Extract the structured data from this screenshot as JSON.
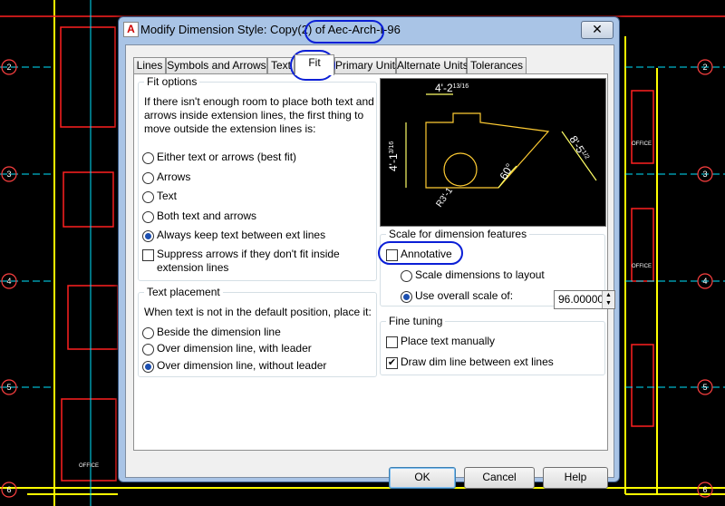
{
  "window": {
    "title_prefix": "Modify Dimension Style: Copy(2) of ",
    "title_style": "Aec-Arch-I-96",
    "app_icon": "A",
    "close_glyph": "✕"
  },
  "tabs": [
    {
      "label": "Lines"
    },
    {
      "label": "Symbols and Arrows"
    },
    {
      "label": "Text"
    },
    {
      "label": "Fit",
      "active": true
    },
    {
      "label": "Primary Units"
    },
    {
      "label": "Alternate Units"
    },
    {
      "label": "Tolerances"
    }
  ],
  "fit_options": {
    "title": "Fit options",
    "description_lines": [
      "If there isn't enough room to place both text and",
      "arrows inside extension lines, the first thing to",
      "move outside the extension lines is:"
    ],
    "radios": [
      {
        "label": "Either text or arrows (best fit)",
        "selected": false
      },
      {
        "label": "Arrows",
        "selected": false
      },
      {
        "label": "Text",
        "selected": false
      },
      {
        "label": "Both text and arrows",
        "selected": false
      },
      {
        "label": "Always keep text between ext lines",
        "selected": true
      }
    ],
    "suppress_lines": [
      "Suppress arrows if they don't fit inside",
      "extension lines"
    ],
    "suppress_checked": false
  },
  "text_placement": {
    "title": "Text placement",
    "description": "When text is not in the default position, place it:",
    "radios": [
      {
        "label": "Beside the dimension line",
        "selected": false
      },
      {
        "label": "Over dimension line, with leader",
        "selected": false
      },
      {
        "label": "Over dimension line, without leader",
        "selected": true
      }
    ]
  },
  "scale": {
    "title": "Scale for dimension features",
    "annotative_label": "Annotative",
    "annotative_checked": false,
    "layout_label": "Scale dimensions to layout",
    "layout_selected": false,
    "overall_label": "Use overall scale of:",
    "overall_selected": true,
    "overall_value": "96.00000"
  },
  "fine_tuning": {
    "title": "Fine tuning",
    "manual_label": "Place text manually",
    "manual_checked": false,
    "drawdim_label": "Draw dim line between ext lines",
    "drawdim_checked": true
  },
  "preview": {
    "top_dim": "4'-2",
    "top_frac": "13/16",
    "left_dim": "4'-1",
    "left_frac": "3/16",
    "right_dim": "8'-5",
    "right_frac": "1/2",
    "angle_dim": "60°",
    "radius_dim": "R3'-1"
  },
  "buttons": {
    "ok": "OK",
    "cancel": "Cancel",
    "help": "Help"
  },
  "background_labels": {
    "grid": [
      "2",
      "3",
      "4",
      "5",
      "6"
    ],
    "office": "OFFICE"
  },
  "colors": {
    "accent": "#1c4fb0",
    "annotation": "#0b1fd6",
    "cad_yellow": "#ffff00",
    "cad_red": "#ff2020"
  }
}
